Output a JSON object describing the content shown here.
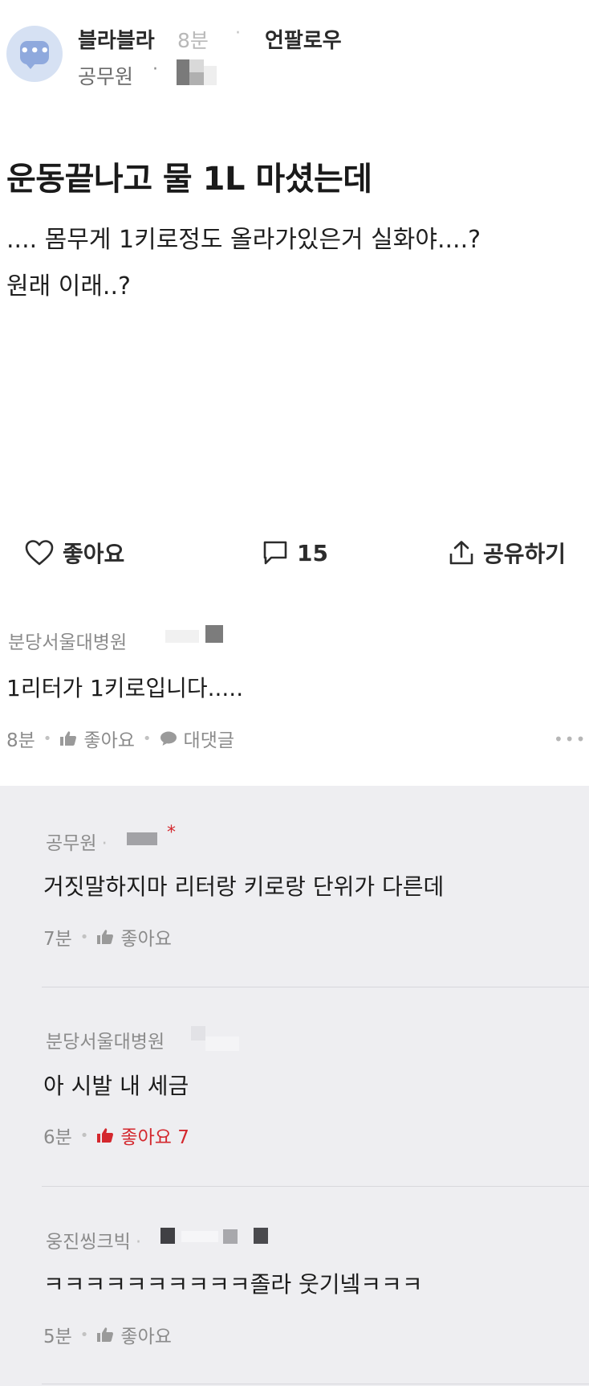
{
  "header": {
    "board_name": "블라블라",
    "time": "8분",
    "separator": "·",
    "unfollow_label": "언팔로우",
    "company": "공무원",
    "company_separator": "·",
    "avatar_glyph": "•••"
  },
  "post": {
    "title": "운동끝나고 물 1L 마셨는데",
    "body_line1": ".... 몸무게 1키로정도 올라가있은거 실화야....?",
    "body_line2": "원래 이래..?"
  },
  "actions": {
    "like_label": "좋아요",
    "comment_count": "15",
    "share_label": "공유하기"
  },
  "comment": {
    "author": "분당서울대병원",
    "text": "1리터가 1키로입니다.....",
    "time": "8분",
    "like_label": "좋아요",
    "reply_label": "대댓글",
    "more": "•••"
  },
  "replies": [
    {
      "author": "공무원",
      "mark": "*",
      "text": "거짓말하지마 리터랑 키로랑 단위가 다른데",
      "time": "7분",
      "like_label": "좋아요"
    },
    {
      "author": "분당서울대병원",
      "text": "아 시발 내 세금",
      "time": "6분",
      "like_label": "좋아요 7"
    },
    {
      "author": "웅진씽크빅",
      "text": "ㅋㅋㅋㅋㅋㅋㅋㅋㅋㅋ졸라 웃기넼ㅋㅋㅋ",
      "time": "5분",
      "like_label": "좋아요"
    }
  ],
  "colors": {
    "accent_like": "#d4282e",
    "reply_background": "#eeeef1",
    "avatar_bg": "#d6e1f3",
    "avatar_bubble": "#8fa9dd"
  },
  "icons": {
    "like": "heart-icon",
    "comment": "comment-icon",
    "share": "share-icon",
    "thumb": "thumbs-up-icon",
    "reply": "speech-bubble-icon",
    "more": "more-icon"
  }
}
